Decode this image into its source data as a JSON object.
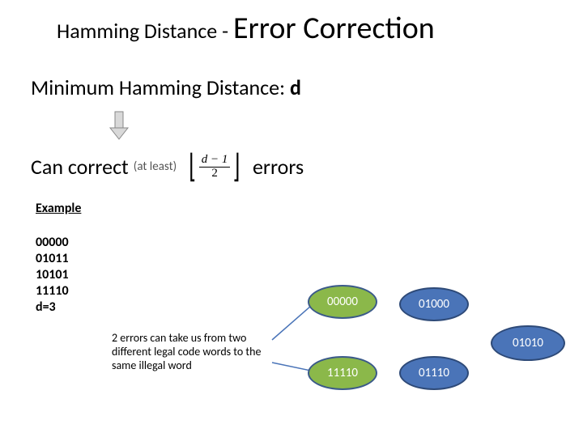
{
  "title": {
    "small": "Hamming Distance - ",
    "big": "Error Correction"
  },
  "subtitle_prefix": "Minimum Hamming Distance: ",
  "subtitle_var": "d",
  "cancorrect": {
    "lead": "Can correct",
    "atleast": "(at least)",
    "formula_num": "d − 1",
    "formula_den": "2",
    "trail": "errors"
  },
  "example_label": "Example",
  "codewords": [
    "00000",
    "01011",
    "10101",
    "11110",
    "d=3"
  ],
  "note": "2 errors can take us from two different legal code words to the same illegal word",
  "ovals": {
    "o1": "00000",
    "o2": "01000",
    "o3": "11110",
    "o4": "01110",
    "o5": "01010"
  }
}
